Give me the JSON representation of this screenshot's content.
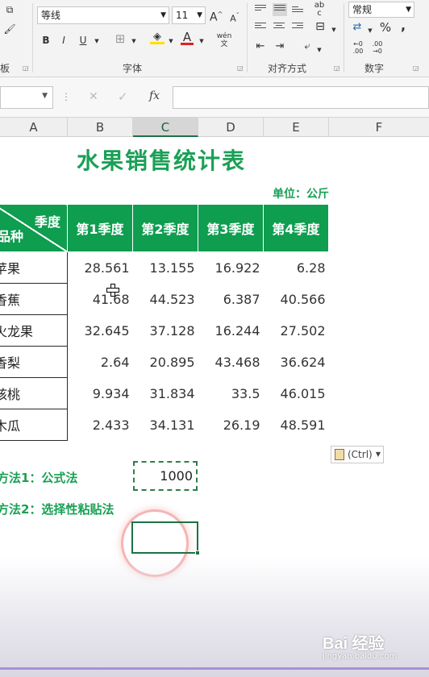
{
  "ribbon": {
    "font_name": "等线",
    "font_size": "11",
    "font_group_label": "字体",
    "align_group_label": "对齐方式",
    "number_group_label": "数字",
    "number_format": "常规",
    "percent_symbol": "%",
    "comma_symbol": ",",
    "bold": "B",
    "italic": "I",
    "underline": "U",
    "font_color_glyph": "A",
    "wen_glyph": "wén",
    "increase_font": "A",
    "decrease_font": "A",
    "left_stub": "板"
  },
  "formula_bar": {
    "fx": "fx",
    "cancel": "✕",
    "enter": "✓"
  },
  "columns": [
    "A",
    "B",
    "C",
    "D",
    "E",
    "F"
  ],
  "selected_column": "C",
  "sheet": {
    "title": "水果销售统计表",
    "unit": "单位：公斤",
    "corner_top": "季度",
    "corner_bottom": "品种",
    "headers": [
      "第1季度",
      "第2季度",
      "第3季度",
      "第4季度"
    ],
    "rows": [
      {
        "name": "苹果",
        "values": [
          "28.561",
          "13.155",
          "16.922",
          "6.28"
        ]
      },
      {
        "name": "香蕉",
        "values": [
          "41.68",
          "44.523",
          "6.387",
          "40.566"
        ]
      },
      {
        "name": "火龙果",
        "values": [
          "32.645",
          "37.128",
          "16.244",
          "27.502"
        ]
      },
      {
        "name": "香梨",
        "values": [
          "2.64",
          "20.895",
          "43.468",
          "36.624"
        ]
      },
      {
        "name": "核桃",
        "values": [
          "9.934",
          "31.834",
          "33.5",
          "46.015"
        ]
      },
      {
        "name": "木瓜",
        "values": [
          "2.433",
          "34.131",
          "26.19",
          "48.591"
        ]
      }
    ],
    "paste_options": "(Ctrl)",
    "method1": "方法1：公式法",
    "method2": "方法2：选择性粘贴法",
    "copied_value": "1000"
  },
  "watermark": {
    "logo": "Bai 经验",
    "url": "jingyan.baidu.com"
  },
  "colors": {
    "accent_green": "#1aa055",
    "header_green": "#0f9d50",
    "excel_green": "#1e7145"
  }
}
